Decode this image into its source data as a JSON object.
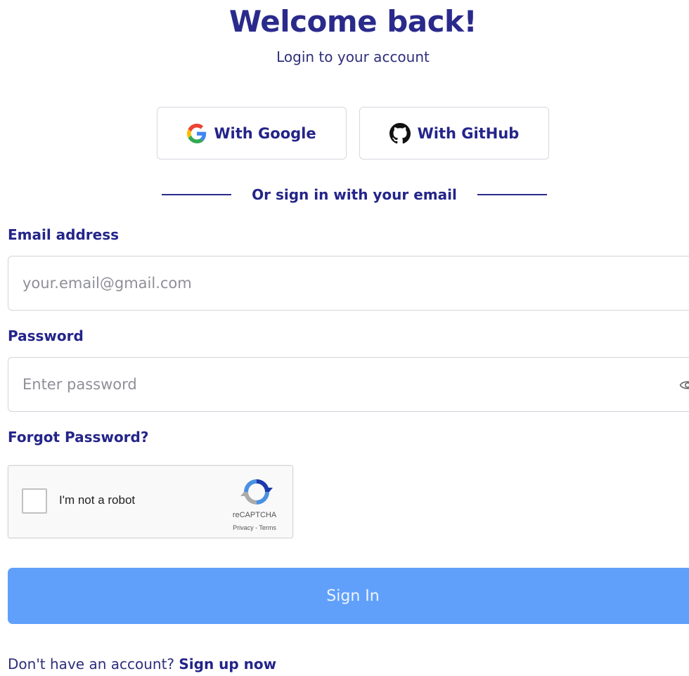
{
  "header": {
    "title": "Welcome back!",
    "subtitle": "Login to your account"
  },
  "social": {
    "google_label": "With Google",
    "github_label": "With GitHub",
    "google_icon": "google-icon",
    "github_icon": "github-icon"
  },
  "divider": {
    "text": "Or sign in with your email"
  },
  "form": {
    "email_label": "Email address",
    "email_placeholder": "your.email@gmail.com",
    "email_value": "",
    "password_label": "Password",
    "password_placeholder": "Enter password",
    "password_value": "",
    "password_toggle_icon": "eye-icon",
    "forgot_label": "Forgot Password?",
    "submit_label": "Sign In"
  },
  "captcha": {
    "checkbox_label": "I'm not a robot",
    "checked": false,
    "brand": "reCAPTCHA",
    "links": "Privacy - Terms",
    "icon": "recaptcha-logo-icon"
  },
  "footer": {
    "prompt": "Don't have an account?",
    "link_label": "Sign up now"
  },
  "colors": {
    "heading": "#2a2a8c",
    "button_primary": "#60a0fb",
    "border": "#d4d4dc"
  }
}
